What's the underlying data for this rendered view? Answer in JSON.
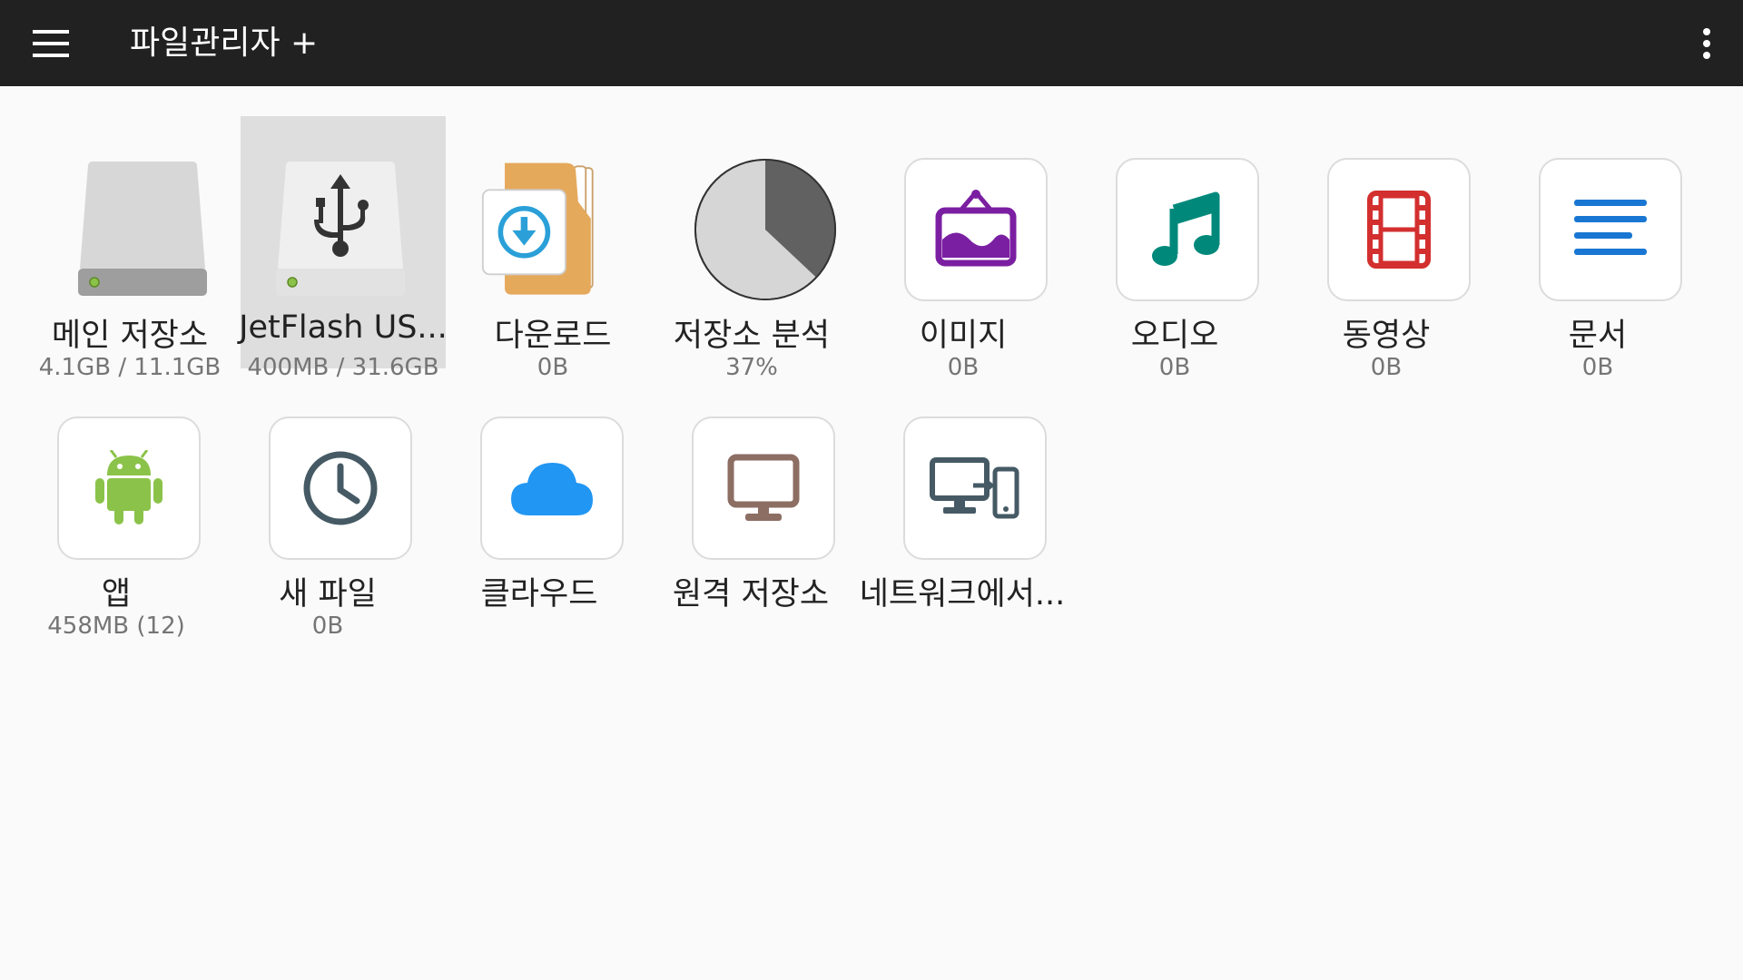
{
  "appbar": {
    "title": "파일관리자 +",
    "menu_icon": "hamburger-menu-icon",
    "overflow_icon": "more-vert-icon",
    "background": "#212121"
  },
  "tiles": [
    {
      "id": "main-storage",
      "label": "메인 저장소",
      "sub": "4.1GB / 11.1GB",
      "icon": "internal-storage-icon"
    },
    {
      "id": "usb-storage",
      "label": "JetFlash US...",
      "sub": "400MB / 31.6GB",
      "icon": "usb-drive-icon",
      "selected": true
    },
    {
      "id": "downloads",
      "label": "다운로드",
      "sub": "0B",
      "icon": "downloads-folder-icon"
    },
    {
      "id": "storage-analysis",
      "label": "저장소 분석",
      "sub": "37%",
      "icon": "storage-pie-chart-icon",
      "used_percent": 37
    },
    {
      "id": "images",
      "label": "이미지",
      "sub": "0B",
      "icon": "image-icon",
      "color": "#7b1fa2"
    },
    {
      "id": "audio",
      "label": "오디오",
      "sub": "0B",
      "icon": "music-note-icon",
      "color": "#00897b"
    },
    {
      "id": "videos",
      "label": "동영상",
      "sub": "0B",
      "icon": "film-icon",
      "color": "#d32f2f"
    },
    {
      "id": "documents",
      "label": "문서",
      "sub": "0B",
      "icon": "document-lines-icon",
      "color": "#1976d2"
    },
    {
      "id": "apps",
      "label": "앱",
      "sub": "458MB (12)",
      "icon": "android-icon",
      "color": "#8bc34a"
    },
    {
      "id": "new-files",
      "label": "새 파일",
      "sub": "0B",
      "icon": "clock-icon",
      "color": "#455a64"
    },
    {
      "id": "cloud",
      "label": "클라우드",
      "sub": "",
      "icon": "cloud-icon",
      "color": "#2196f3"
    },
    {
      "id": "remote-storage",
      "label": "원격 저장소",
      "sub": "",
      "icon": "monitor-icon",
      "color": "#8d6e63"
    },
    {
      "id": "network",
      "label": "네트워크에서...",
      "sub": "",
      "icon": "devices-icon",
      "color": "#455a64"
    }
  ]
}
